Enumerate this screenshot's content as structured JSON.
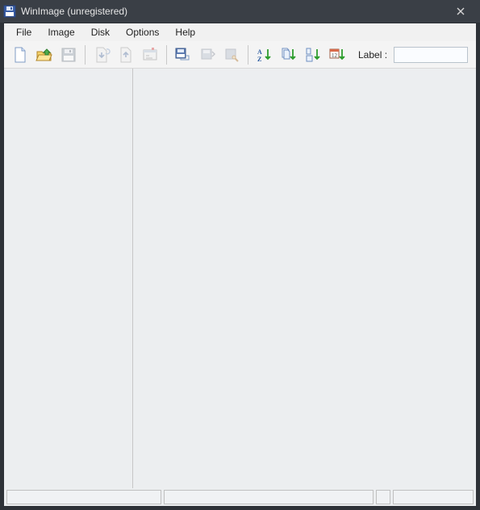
{
  "window": {
    "title": "WinImage (unregistered)"
  },
  "menu": {
    "file": "File",
    "image": "Image",
    "disk": "Disk",
    "options": "Options",
    "help": "Help"
  },
  "toolbar": {
    "label_caption": "Label :",
    "label_value": ""
  },
  "status": {
    "cell1": "",
    "cell2": "",
    "cell3": "",
    "cell4": ""
  }
}
